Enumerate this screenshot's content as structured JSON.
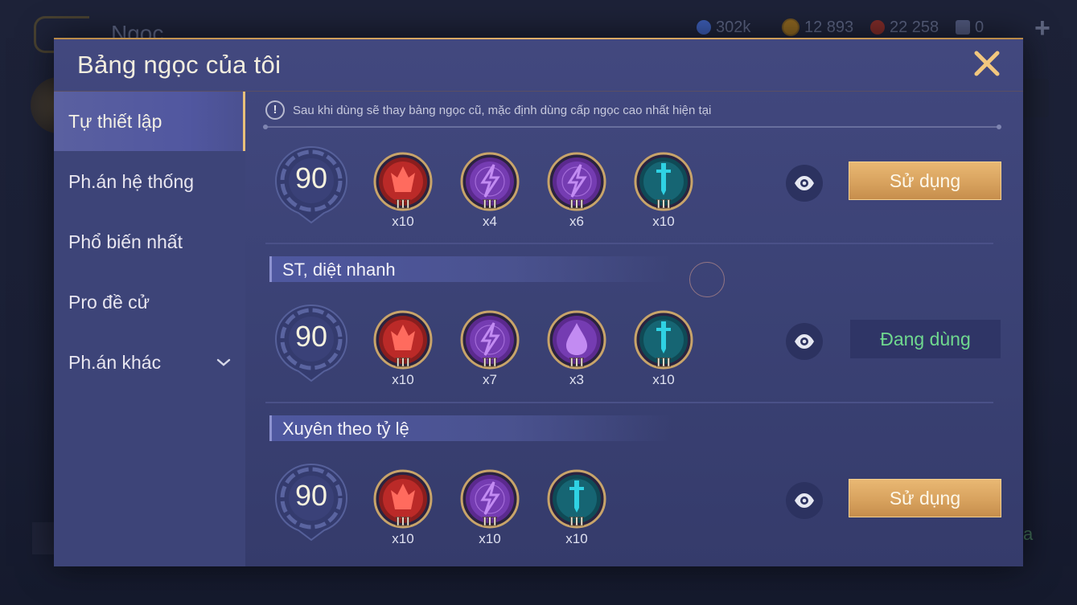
{
  "background": {
    "title": "Ngọc",
    "resources": [
      {
        "name": "blue-gem",
        "value": "302k",
        "color": "#3b5bb0"
      },
      {
        "name": "gold-coin",
        "value": "12 893",
        "color": "#c9912e"
      },
      {
        "name": "red-gem",
        "value": "22 258",
        "color": "#b53a35"
      },
      {
        "name": "card",
        "value": "0",
        "color": "#6e7aa8"
      }
    ],
    "bottom_right": "a"
  },
  "dialog": {
    "title": "Bảng ngọc của tôi",
    "notice": "Sau khi dùng sẽ thay bảng ngọc cũ, mặc định dùng cấp ngọc cao nhất hiện tại"
  },
  "sidebar": {
    "items": [
      {
        "label": "Tự thiết lập",
        "active": true
      },
      {
        "label": "Ph.án hệ thống",
        "active": false
      },
      {
        "label": "Phổ biến nhất",
        "active": false
      },
      {
        "label": "Pro đề cử",
        "active": false
      },
      {
        "label": "Ph.án khác",
        "active": false
      }
    ]
  },
  "setups": [
    {
      "name": "",
      "level": "90",
      "gems": [
        {
          "type": "red-attack",
          "tier": "III",
          "count": "x10"
        },
        {
          "type": "purple-lightning",
          "tier": "III",
          "count": "x4"
        },
        {
          "type": "purple-lightning",
          "tier": "III",
          "count": "x6"
        },
        {
          "type": "teal-sword",
          "tier": "III",
          "count": "x10"
        }
      ],
      "button": "Sử dụng",
      "in_use": false
    },
    {
      "name": "ST, diệt nhanh",
      "level": "90",
      "gems": [
        {
          "type": "red-attack",
          "tier": "III",
          "count": "x10"
        },
        {
          "type": "purple-lightning",
          "tier": "III",
          "count": "x7"
        },
        {
          "type": "purple-drop",
          "tier": "III",
          "count": "x3"
        },
        {
          "type": "teal-sword",
          "tier": "III",
          "count": "x10"
        }
      ],
      "button": "Đang dùng",
      "in_use": true
    },
    {
      "name": "Xuyên theo tỷ lệ",
      "level": "90",
      "gems": [
        {
          "type": "red-attack",
          "tier": "III",
          "count": "x10"
        },
        {
          "type": "purple-lightning",
          "tier": "III",
          "count": "x10"
        },
        {
          "type": "teal-sword",
          "tier": "III",
          "count": "x10"
        }
      ],
      "button": "Sử dụng",
      "in_use": false
    }
  ],
  "colors": {
    "accent_gold": "#e2b06a",
    "in_use_green": "#6fd88f",
    "dialog_bg": "#3b4275"
  }
}
